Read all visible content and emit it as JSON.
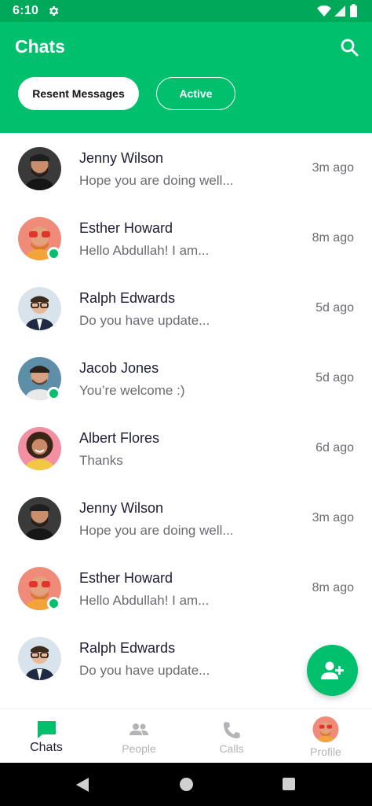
{
  "status_bar": {
    "time": "6:10"
  },
  "header": {
    "title": "Chats",
    "filters": [
      {
        "label": "Resent Messages",
        "selected": true
      },
      {
        "label": "Active",
        "selected": false
      }
    ]
  },
  "chats": [
    {
      "name": "Jenny Wilson",
      "preview": "Hope you are doing well...",
      "time": "3m ago",
      "online": false,
      "avatar": "bearded-man"
    },
    {
      "name": "Esther Howard",
      "preview": "Hello Abdullah! I am...",
      "time": "8m ago",
      "online": true,
      "avatar": "man-orange-sunglasses"
    },
    {
      "name": "Ralph Edwards",
      "preview": "Do you have update...",
      "time": "5d ago",
      "online": false,
      "avatar": "man-glasses-suit"
    },
    {
      "name": "Jacob Jones",
      "preview": "You’re welcome :)",
      "time": "5d ago",
      "online": true,
      "avatar": "man-stubble"
    },
    {
      "name": "Albert Flores",
      "preview": "Thanks",
      "time": "6d ago",
      "online": false,
      "avatar": "woman-curly-hair"
    },
    {
      "name": "Jenny Wilson",
      "preview": "Hope you are doing well...",
      "time": "3m ago",
      "online": false,
      "avatar": "bearded-man"
    },
    {
      "name": "Esther Howard",
      "preview": "Hello Abdullah! I am...",
      "time": "8m ago",
      "online": true,
      "avatar": "man-orange-sunglasses"
    },
    {
      "name": "Ralph Edwards",
      "preview": "Do you have update...",
      "time": "",
      "online": false,
      "avatar": "man-glasses-suit"
    }
  ],
  "fab": {
    "icon": "add-person-icon"
  },
  "bottom_nav": {
    "items": [
      {
        "label": "Chats",
        "icon": "chat-bubble-icon",
        "active": true
      },
      {
        "label": "People",
        "icon": "people-icon",
        "active": false
      },
      {
        "label": "Calls",
        "icon": "phone-icon",
        "active": false
      },
      {
        "label": "Profile",
        "icon": "profile-avatar",
        "active": false
      }
    ]
  },
  "colors": {
    "primary": "#00bf6d",
    "status_bar": "#00a85a",
    "text_dark": "#1d1d35",
    "text_muted": "#6b6b73"
  }
}
